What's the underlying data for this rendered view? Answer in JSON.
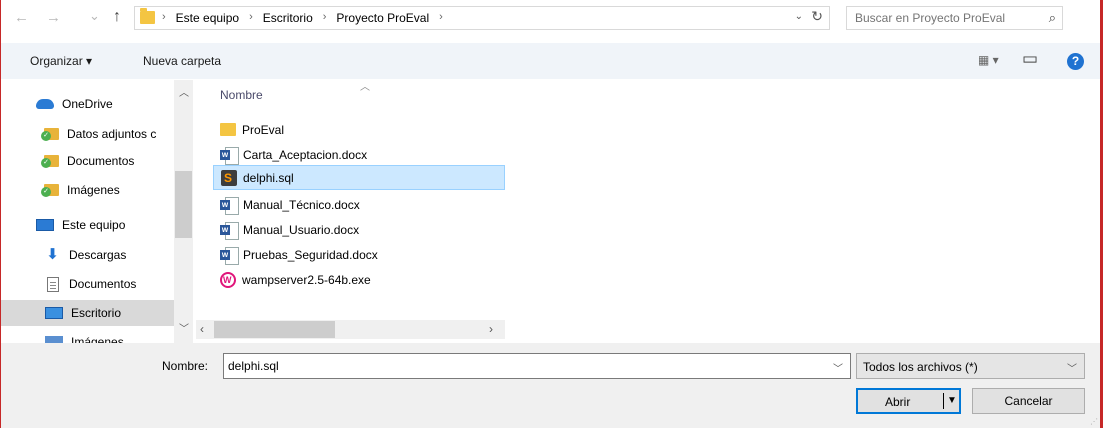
{
  "address_bar": {
    "back": "←",
    "forward": "→",
    "recent": "⌄",
    "up": "↑",
    "breadcrumbs": [
      "Este equipo",
      "Escritorio",
      "Proyecto ProEval"
    ],
    "separator": "›",
    "dropdown": "⌄",
    "refresh": "↻"
  },
  "search": {
    "placeholder": "Buscar en Proyecto ProEval",
    "icon": "search-icon"
  },
  "toolbar": {
    "organize": "Organizar ▾",
    "new_folder": "Nueva carpeta",
    "view_menu": "▦ ▾",
    "preview_pane": "▭",
    "help": "?"
  },
  "nav_pane": {
    "items": [
      {
        "label": "OneDrive",
        "icon": "onedrive-cloud-icon"
      },
      {
        "label": "Datos adjuntos c",
        "icon": "synced-folder-icon"
      },
      {
        "label": "Documentos",
        "icon": "synced-folder-icon"
      },
      {
        "label": "Imágenes",
        "icon": "synced-folder-icon"
      },
      {
        "label": "Este equipo",
        "icon": "computer-icon"
      },
      {
        "label": "Descargas",
        "icon": "download-arrow-icon"
      },
      {
        "label": "Documentos",
        "icon": "document-icon"
      },
      {
        "label": "Escritorio",
        "icon": "desktop-icon",
        "selected": true
      },
      {
        "label": "Imágenes",
        "icon": "pictures-icon"
      }
    ]
  },
  "file_list": {
    "column_header": "Nombre",
    "files": [
      {
        "name": "ProEval",
        "icon": "folder-icon"
      },
      {
        "name": "Carta_Aceptacion.docx",
        "icon": "word-doc-icon"
      },
      {
        "name": "delphi.sql",
        "icon": "sublime-text-icon",
        "selected": true
      },
      {
        "name": "Manual_Técnico.docx",
        "icon": "word-doc-icon"
      },
      {
        "name": "Manual_Usuario.docx",
        "icon": "word-doc-icon"
      },
      {
        "name": "Pruebas_Seguridad.docx",
        "icon": "word-doc-icon"
      },
      {
        "name": "wampserver2.5-64b.exe",
        "icon": "wampserver-icon"
      }
    ]
  },
  "footer": {
    "name_label": "Nombre:",
    "name_value": "delphi.sql",
    "file_type": "Todos los archivos (*)",
    "open_button": "Abrir",
    "cancel_button": "Cancelar"
  },
  "colors": {
    "accent": "#0078d7",
    "selection_bg": "#cce8ff",
    "toolbar_bg": "#f0f4f9",
    "help_blue": "#1f72d1"
  }
}
